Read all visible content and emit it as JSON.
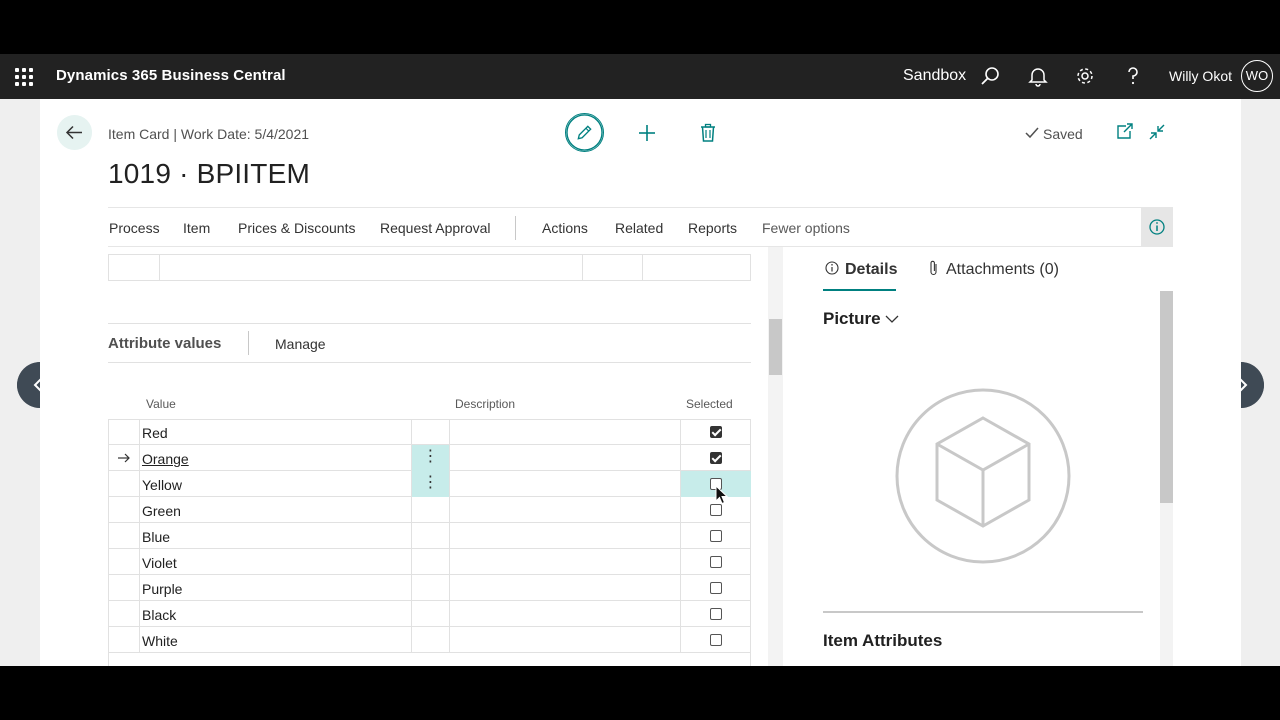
{
  "topbar": {
    "app_title": "Dynamics 365 Business Central",
    "environment": "Sandbox",
    "user_name": "Willy Okot",
    "user_initials": "WO"
  },
  "header": {
    "breadcrumb": "Item Card | Work Date: 5/4/2021",
    "title": "1019 · BPIITEM",
    "saved_label": "Saved"
  },
  "actions": {
    "process": "Process",
    "item": "Item",
    "prices": "Prices & Discounts",
    "request_approval": "Request Approval",
    "actions": "Actions",
    "related": "Related",
    "reports": "Reports",
    "fewer_options": "Fewer options"
  },
  "attributes": {
    "section_title": "Attribute values",
    "manage_label": "Manage",
    "columns": {
      "value": "Value",
      "description": "Description",
      "selected": "Selected"
    },
    "rows": [
      {
        "value": "Red",
        "selected": true
      },
      {
        "value": "Orange",
        "selected": true
      },
      {
        "value": "Yellow",
        "selected": false
      },
      {
        "value": "Green",
        "selected": false
      },
      {
        "value": "Blue",
        "selected": false
      },
      {
        "value": "Violet",
        "selected": false
      },
      {
        "value": "Purple",
        "selected": false
      },
      {
        "value": "Black",
        "selected": false
      },
      {
        "value": "White",
        "selected": false
      }
    ]
  },
  "factbox": {
    "tab_details": "Details",
    "tab_attachments": "Attachments (0)",
    "picture_title": "Picture",
    "item_attributes_title": "Item Attributes"
  },
  "colors": {
    "accent": "#008080",
    "topbar": "#222222",
    "row_highlight": "#c7ecea"
  }
}
